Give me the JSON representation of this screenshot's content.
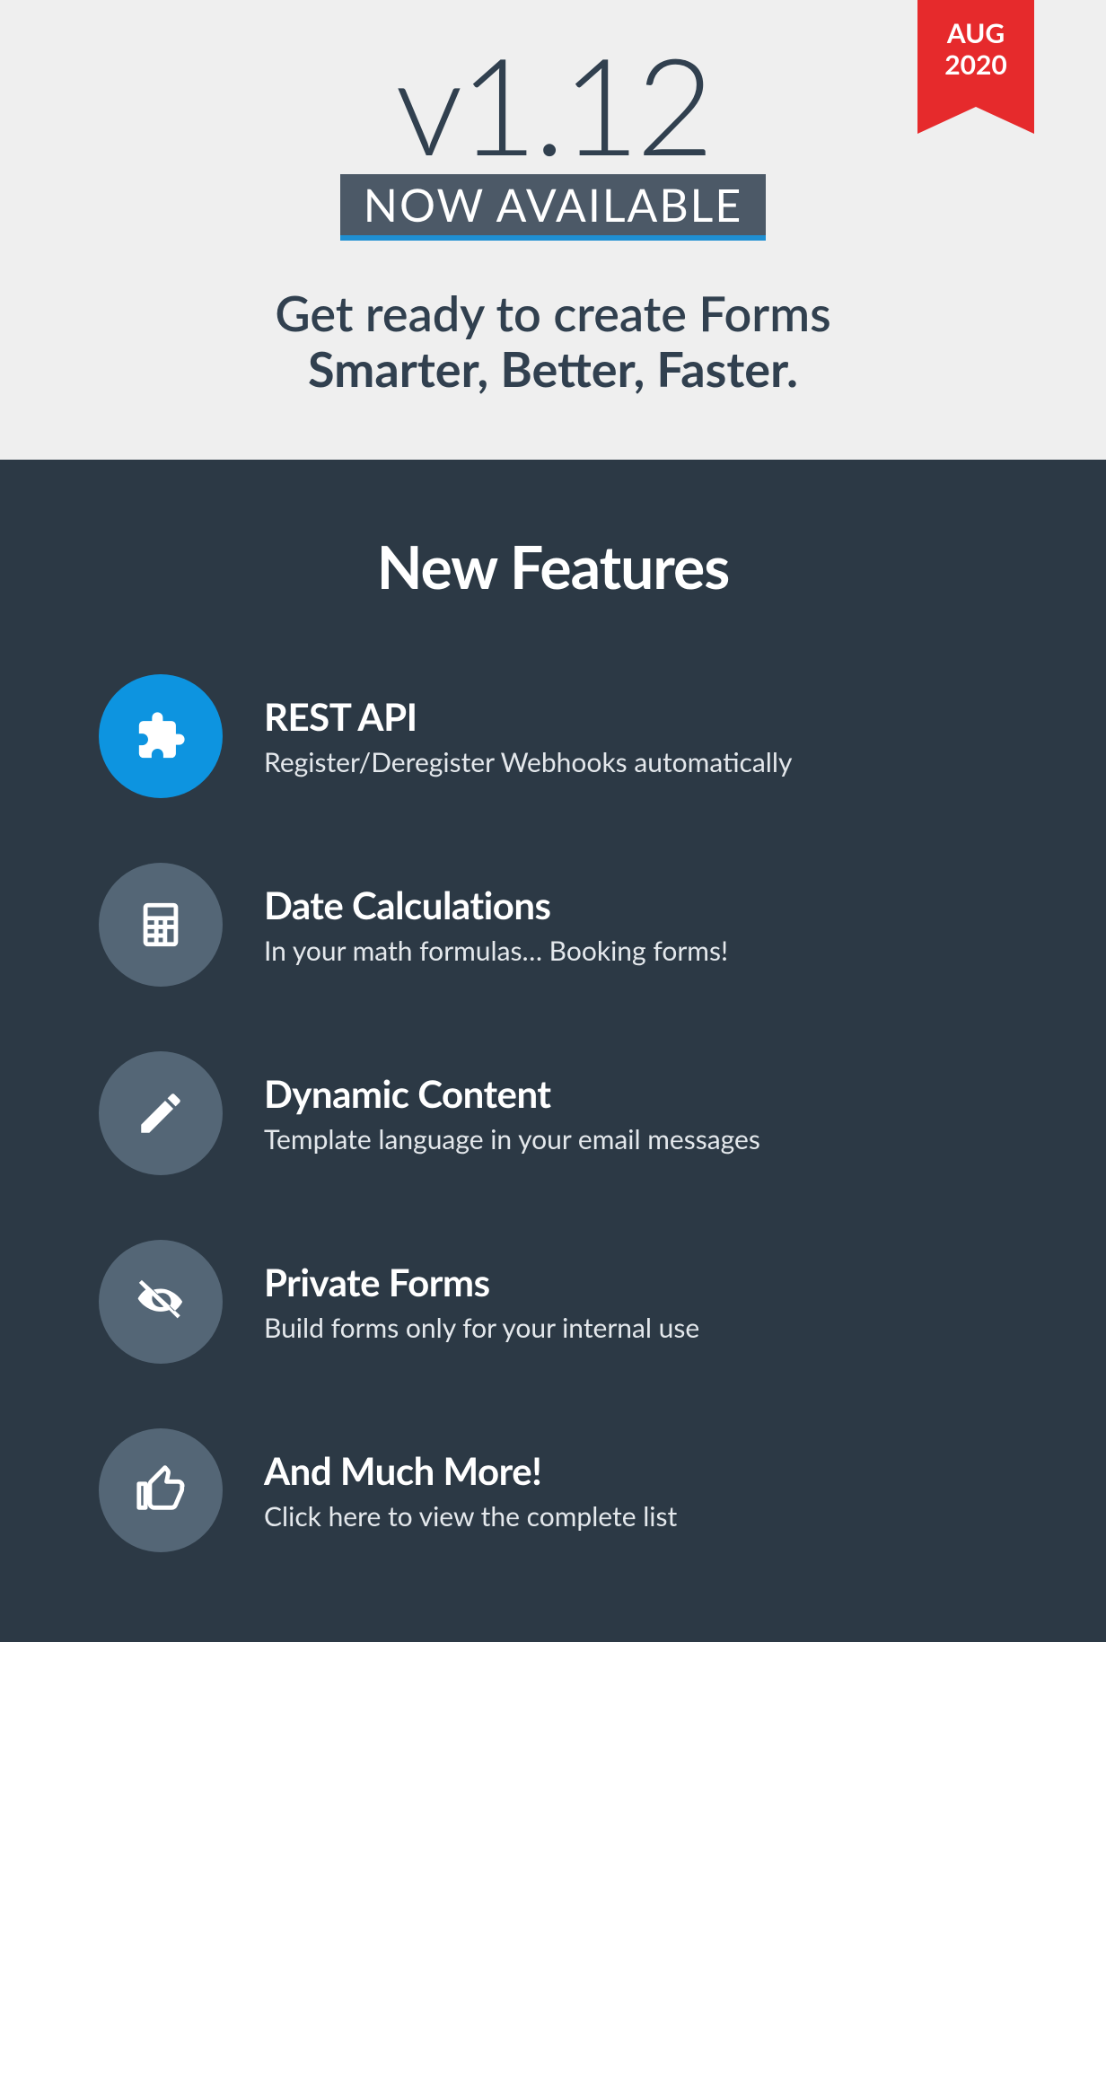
{
  "hero": {
    "ribbon_month": "AUG",
    "ribbon_year": "2020",
    "version": "v1.12",
    "now_available": "NOW AVAILABLE",
    "tagline_line1": "Get ready to create Forms",
    "tagline_line2": "Smarter, Better, Faster."
  },
  "features": {
    "title": "New Features",
    "items": [
      {
        "icon": "puzzle",
        "title": "REST API",
        "desc": "Register/Deregister Webhooks automatically",
        "highlight": true
      },
      {
        "icon": "calculator",
        "title": "Date Calculations",
        "desc": "In your math formulas… Booking forms!",
        "highlight": false
      },
      {
        "icon": "pencil",
        "title": "Dynamic Content",
        "desc": "Template language in your email messages",
        "highlight": false
      },
      {
        "icon": "eye-slash",
        "title": "Private Forms",
        "desc": "Build forms only for your internal use",
        "highlight": false
      },
      {
        "icon": "thumbs-up",
        "title": "And Much More!",
        "desc": "Click here to view the complete list",
        "highlight": false
      }
    ]
  }
}
